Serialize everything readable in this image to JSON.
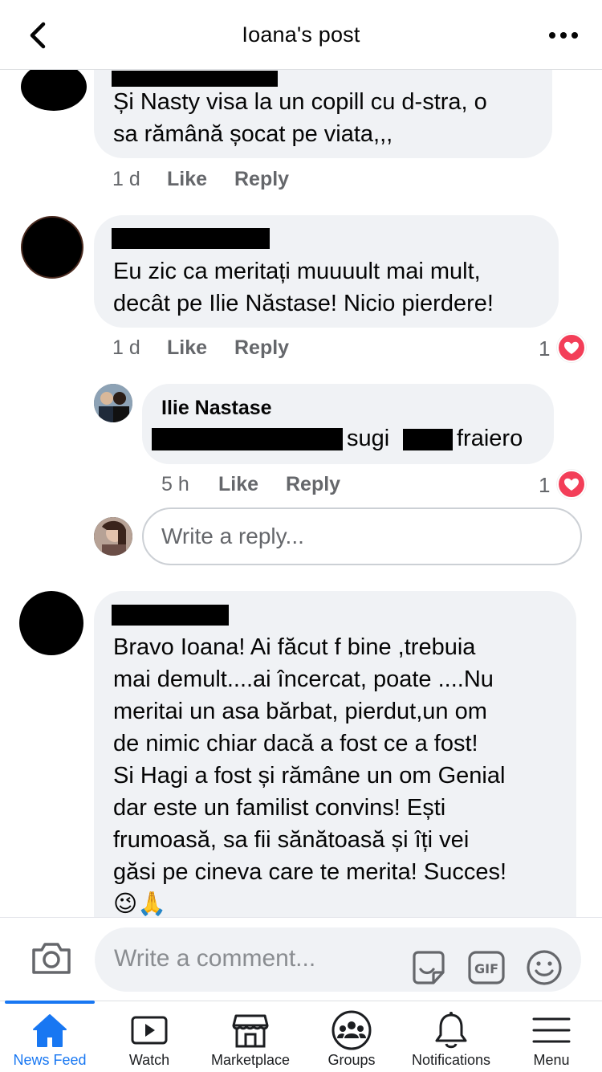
{
  "header": {
    "title": "Ioana's post"
  },
  "comments": [
    {
      "text": "Și Nasty visa la un copill cu d-stra, o\nsa rămână șocat pe viata,,,",
      "time": "1 d",
      "like": "Like",
      "reply": "Reply"
    },
    {
      "text": "Eu zic ca meritați muuuult mai mult,\ndecât pe Ilie Năstase! Nicio pierdere!",
      "time": "1 d",
      "like": "Like",
      "reply": "Reply",
      "reactions": "1"
    },
    {
      "text": "Bravo Ioana! Ai făcut f bine ,trebuia\nmai demult....ai încercat, poate ....Nu\nmeritai un asa bărbat, pierdut,un om\nde nimic chiar dacă  a fost  ce a fost!\nSi Hagi a fost și  rămâne  un om Genial\ndar este un familist  convins! Ești\nfrumoasă, sa fii sănătoasă  și îți vei\ngăsi pe cineva care te merita! Succes!\n😉🙏"
    }
  ],
  "reply": {
    "author": "Ilie Nastase",
    "text_part1": "sugi",
    "text_part2": "fraiero",
    "time": "5 h",
    "like": "Like",
    "reply": "Reply",
    "reactions": "1"
  },
  "reply_input": {
    "placeholder": "Write a reply..."
  },
  "composer": {
    "placeholder": "Write a comment..."
  },
  "tabs": [
    {
      "label": "News Feed",
      "icon": "home-icon",
      "active": true
    },
    {
      "label": "Watch",
      "icon": "watch-icon"
    },
    {
      "label": "Marketplace",
      "icon": "marketplace-icon"
    },
    {
      "label": "Groups",
      "icon": "groups-icon"
    },
    {
      "label": "Notifications",
      "icon": "bell-icon"
    },
    {
      "label": "Menu",
      "icon": "menu-icon"
    }
  ],
  "colors": {
    "accent": "#1877f2",
    "bubble": "#f0f2f5",
    "heart": "#f33e58",
    "meta": "#65676b"
  }
}
